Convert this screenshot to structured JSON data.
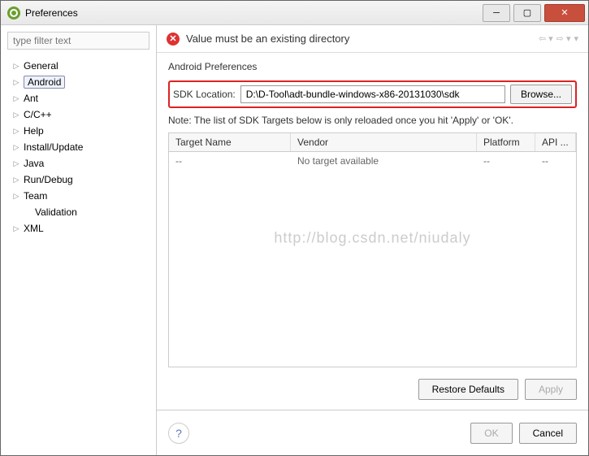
{
  "window": {
    "title": "Preferences"
  },
  "sidebar": {
    "filter_placeholder": "type filter text",
    "items": [
      {
        "label": "General",
        "expandable": true
      },
      {
        "label": "Android",
        "expandable": true,
        "selected": true
      },
      {
        "label": "Ant",
        "expandable": true
      },
      {
        "label": "C/C++",
        "expandable": true
      },
      {
        "label": "Help",
        "expandable": true
      },
      {
        "label": "Install/Update",
        "expandable": true
      },
      {
        "label": "Java",
        "expandable": true
      },
      {
        "label": "Run/Debug",
        "expandable": true
      },
      {
        "label": "Team",
        "expandable": true
      },
      {
        "label": "Validation",
        "expandable": false,
        "sub": true
      },
      {
        "label": "XML",
        "expandable": true
      }
    ]
  },
  "error_message": "Value must be an existing directory",
  "section_title": "Android Preferences",
  "sdk_label": "SDK Location:",
  "sdk_value": "D:\\D-Tool\\adt-bundle-windows-x86-20131030\\sdk",
  "browse_label": "Browse...",
  "note": "Note: The list of SDK Targets below is only reloaded once you hit 'Apply' or 'OK'.",
  "table": {
    "headers": {
      "tname": "Target Name",
      "vendor": "Vendor",
      "platform": "Platform",
      "api": "API ..."
    },
    "row": {
      "tname": "--",
      "vendor": "No target available",
      "platform": "--",
      "api": "--"
    }
  },
  "watermark": "http://blog.csdn.net/niudaly",
  "buttons": {
    "restore": "Restore Defaults",
    "apply": "Apply",
    "ok": "OK",
    "cancel": "Cancel"
  }
}
